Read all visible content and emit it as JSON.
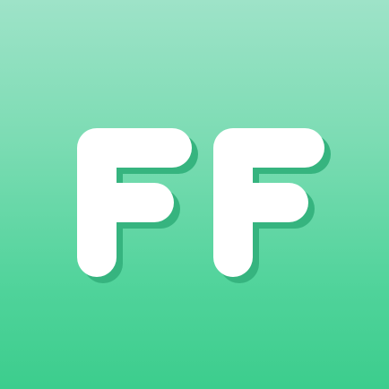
{
  "app_icon": {
    "logo_text": "FF",
    "logo_icon": "ff-letters-icon",
    "colors": {
      "gradient_top": "#9ee3c8",
      "gradient_bottom": "#3ccd8d",
      "letter_fill": "#ffffff",
      "letter_shadow": "#36b47f"
    }
  }
}
